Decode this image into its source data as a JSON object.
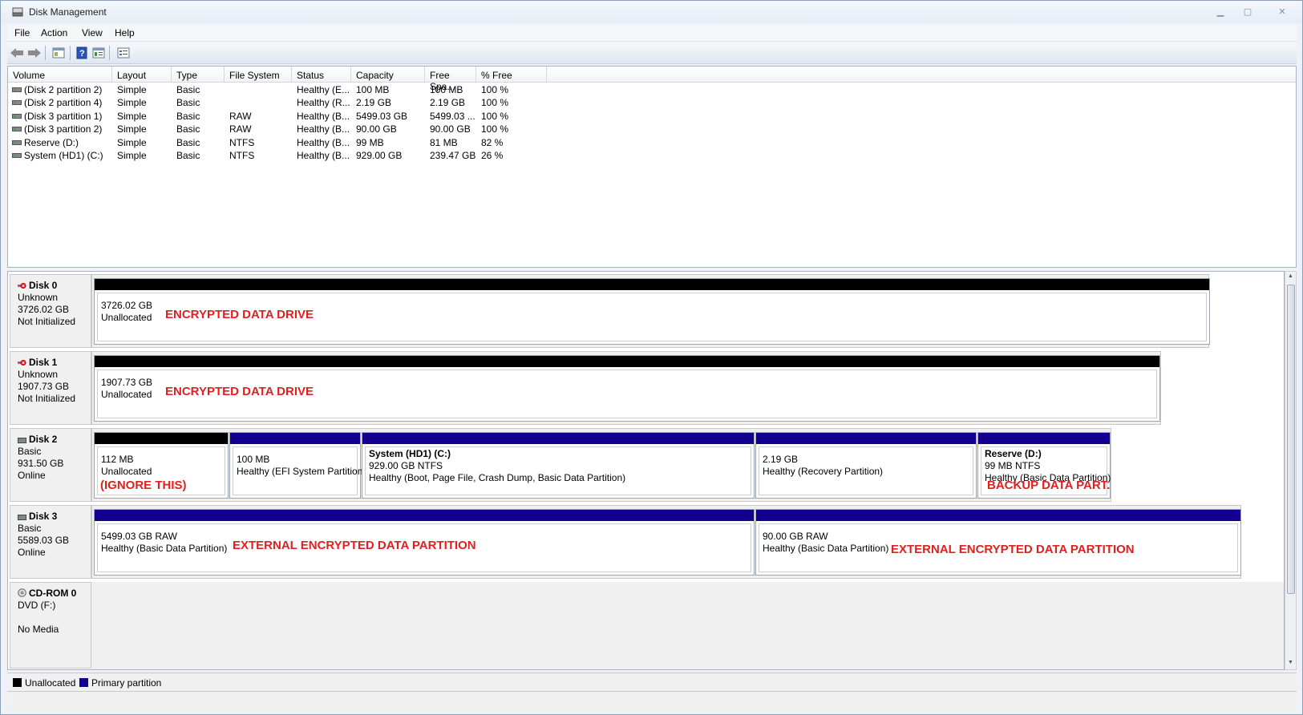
{
  "window": {
    "title": "Disk Management"
  },
  "menu": {
    "file": "File",
    "action": "Action",
    "view": "View",
    "help": "Help"
  },
  "columns": [
    "Volume",
    "Layout",
    "Type",
    "File System",
    "Status",
    "Capacity",
    "Free Spa...",
    "% Free"
  ],
  "volumes": [
    {
      "volume": "(Disk 2 partition 2)",
      "layout": "Simple",
      "type": "Basic",
      "fs": "",
      "status": "Healthy (E...",
      "capacity": "100 MB",
      "free": "100 MB",
      "pct": "100 %"
    },
    {
      "volume": "(Disk 2 partition 4)",
      "layout": "Simple",
      "type": "Basic",
      "fs": "",
      "status": "Healthy (R...",
      "capacity": "2.19 GB",
      "free": "2.19 GB",
      "pct": "100 %"
    },
    {
      "volume": "(Disk 3 partition 1)",
      "layout": "Simple",
      "type": "Basic",
      "fs": "RAW",
      "status": "Healthy (B...",
      "capacity": "5499.03 GB",
      "free": "5499.03 ...",
      "pct": "100 %"
    },
    {
      "volume": "(Disk 3 partition 2)",
      "layout": "Simple",
      "type": "Basic",
      "fs": "RAW",
      "status": "Healthy (B...",
      "capacity": "90.00 GB",
      "free": "90.00 GB",
      "pct": "100 %"
    },
    {
      "volume": "Reserve (D:)",
      "layout": "Simple",
      "type": "Basic",
      "fs": "NTFS",
      "status": "Healthy (B...",
      "capacity": "99 MB",
      "free": "81 MB",
      "pct": "82 %"
    },
    {
      "volume": "System (HD1) (C:)",
      "layout": "Simple",
      "type": "Basic",
      "fs": "NTFS",
      "status": "Healthy (B...",
      "capacity": "929.00 GB",
      "free": "239.47 GB",
      "pct": "26 %"
    }
  ],
  "disks": [
    {
      "name": "Disk 0",
      "kind": "Unknown",
      "size": "3726.02 GB",
      "state": "Not Initialized",
      "parts": [
        {
          "size": "3726.02 GB",
          "desc": "Unallocated",
          "note": "ENCRYPTED DATA DRIVE"
        }
      ]
    },
    {
      "name": "Disk 1",
      "kind": "Unknown",
      "size": "1907.73 GB",
      "state": "Not Initialized",
      "parts": [
        {
          "size": "1907.73 GB",
          "desc": "Unallocated",
          "note": "ENCRYPTED DATA DRIVE"
        }
      ]
    },
    {
      "name": "Disk 2",
      "kind": "Basic",
      "size": "931.50 GB",
      "state": "Online",
      "parts": [
        {
          "size": "112 MB",
          "desc": "Unallocated",
          "note": "(IGNORE THIS)"
        },
        {
          "size": "100 MB",
          "desc": "Healthy (EFI System Partition)"
        },
        {
          "title": "System (HD1)  (C:)",
          "size": "929.00 GB NTFS",
          "desc": "Healthy (Boot, Page File, Crash Dump, Basic Data Partition)"
        },
        {
          "size": "2.19 GB",
          "desc": "Healthy (Recovery Partition)"
        },
        {
          "title": "Reserve  (D:)",
          "size": "99 MB NTFS",
          "desc": "Healthy (Basic Data Partition)",
          "note": "BACKUP DATA PART."
        }
      ]
    },
    {
      "name": "Disk 3",
      "kind": "Basic",
      "size": "5589.03 GB",
      "state": "Online",
      "parts": [
        {
          "size": "5499.03 GB RAW",
          "desc": "Healthy (Basic Data Partition)",
          "note": "EXTERNAL ENCRYPTED DATA PARTITION"
        },
        {
          "size": "90.00 GB RAW",
          "desc": "Healthy (Basic Data Partition)",
          "note": "EXTERNAL ENCRYPTED DATA PARTITION"
        }
      ]
    },
    {
      "name": "CD-ROM 0",
      "kind": "DVD (F:)",
      "size": "",
      "state": "No Media",
      "parts": []
    }
  ],
  "legend": {
    "unallocated": "Unallocated",
    "primary": "Primary partition"
  },
  "colors": {
    "unallocated": "#000000",
    "primary": "#13008e",
    "note": "#e02020"
  }
}
